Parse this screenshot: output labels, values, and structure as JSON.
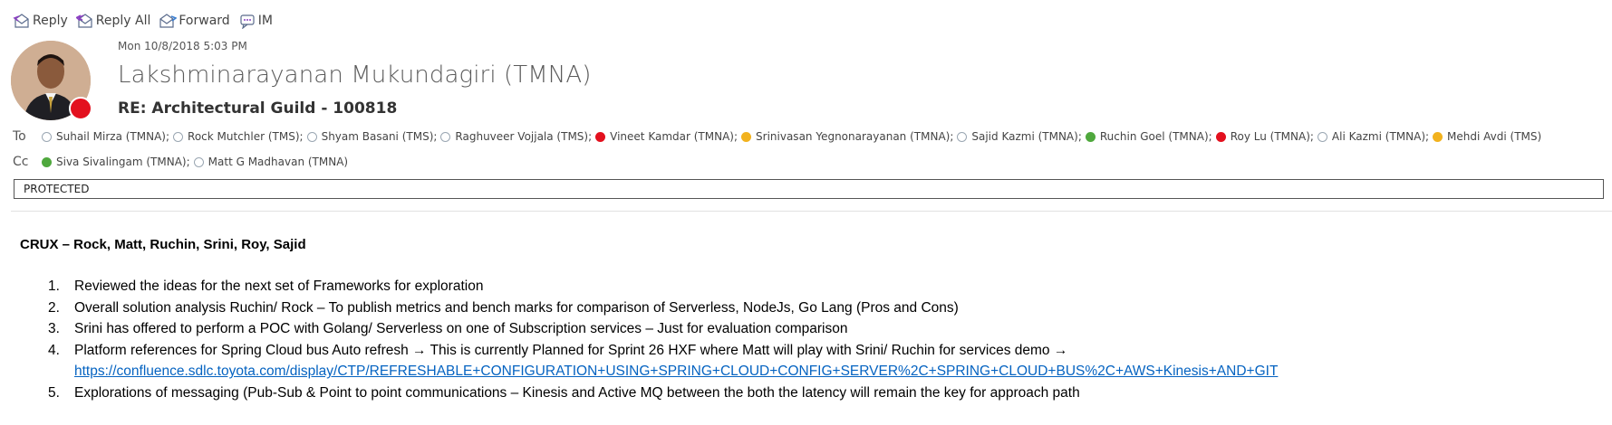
{
  "toolbar": {
    "reply_label": "Reply",
    "reply_all_label": "Reply All",
    "forward_label": "Forward",
    "im_label": "IM"
  },
  "header": {
    "date": "Mon 10/8/2018 5:03 PM",
    "sender": "Lakshminarayanan Mukundagiri (TMNA)",
    "subject": "RE: Architectural Guild - 100818",
    "sender_presence_color": "#e3101e"
  },
  "to": {
    "label": "To",
    "recipients": [
      {
        "name": "Suhail Mirza (TMNA);",
        "status": "unknown"
      },
      {
        "name": "Rock Mutchler (TMS);",
        "status": "unknown"
      },
      {
        "name": "Shyam Basani (TMS);",
        "status": "unknown"
      },
      {
        "name": "Raghuveer Vojjala (TMS);",
        "status": "unknown"
      },
      {
        "name": "Vineet Kamdar (TMNA);",
        "status": "busy"
      },
      {
        "name": "Srinivasan Yegnonarayanan (TMNA);",
        "status": "away"
      },
      {
        "name": "Sajid Kazmi (TMNA);",
        "status": "unknown"
      },
      {
        "name": "Ruchin Goel (TMNA);",
        "status": "available"
      },
      {
        "name": "Roy Lu (TMNA);",
        "status": "busy"
      },
      {
        "name": "Ali Kazmi (TMNA);",
        "status": "unknown"
      },
      {
        "name": "Mehdi Avdi (TMS)",
        "status": "away"
      }
    ]
  },
  "cc": {
    "label": "Cc",
    "recipients": [
      {
        "name": "Siva Sivalingam (TMNA);",
        "status": "available"
      },
      {
        "name": "Matt G Madhavan (TMNA)",
        "status": "unknown"
      }
    ]
  },
  "classification": "PROTECTED",
  "body": {
    "crux": "CRUX – Rock, Matt, Ruchin, Srini, Roy, Sajid",
    "items": [
      {
        "num": "1.",
        "text": "Reviewed the ideas for the next set of Frameworks for exploration"
      },
      {
        "num": "2.",
        "text": "Overall solution analysis Ruchin/ Rock – To publish metrics and bench marks for comparison of Serverless, NodeJs, Go Lang (Pros and Cons)"
      },
      {
        "num": "3.",
        "text": "Srini has offered to perform a POC with Golang/ Serverless on one of Subscription services – Just for evaluation comparison"
      },
      {
        "num": "4.",
        "text": "Platform references for Spring Cloud bus Auto refresh → This is currently Planned for Sprint 26 HXF where Matt will play with Srini/ Ruchin for services demo →"
      },
      {
        "num": "",
        "link": "https://confluence.sdlc.toyota.com/display/CTP/REFRESHABLE+CONFIGURATION+USING+SPRING+CLOUD+CONFIG+SERVER%2C+SPRING+CLOUD+BUS%2C+AWS+Kinesis+AND+GIT"
      },
      {
        "num": "5.",
        "text": "Explorations of messaging (Pub-Sub & Point to point communications – Kinesis and Active MQ between the both the latency will remain the key for approach path"
      }
    ]
  },
  "colors": {
    "busy": "#e3101e",
    "away": "#f2b21e",
    "available": "#4fa83d",
    "link": "#0563c1"
  }
}
